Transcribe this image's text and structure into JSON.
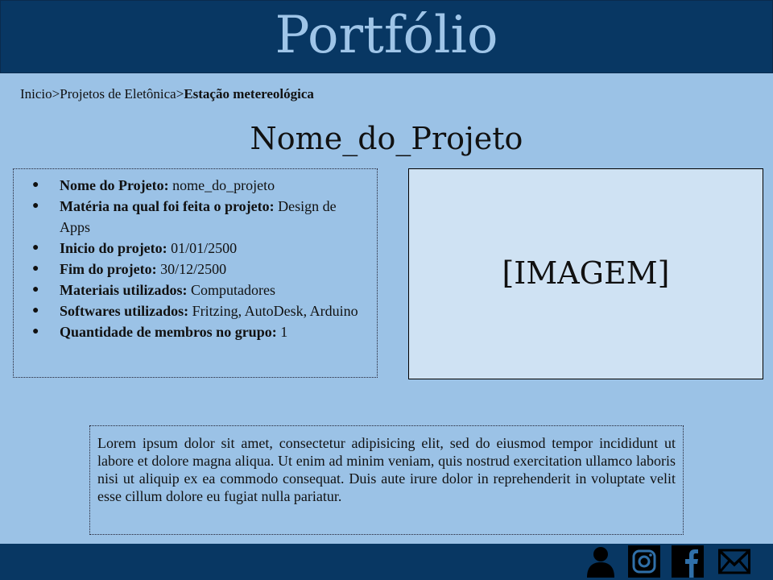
{
  "header": {
    "title": "Portfólio"
  },
  "breadcrumb": {
    "items": [
      "Inicio",
      "Projetos de Eletônica",
      "Estação metereológica"
    ],
    "separator": ">"
  },
  "page": {
    "title": "Nome_do_Projeto"
  },
  "info": {
    "items": [
      {
        "label": "Nome do Projeto:",
        "value": "nome_do_projeto"
      },
      {
        "label": "Matéria na qual foi feita o projeto:",
        "value": "Design de Apps"
      },
      {
        "label": "Inicio do projeto:",
        "value": "01/01/2500"
      },
      {
        "label": "Fim do projeto:",
        "value": "30/12/2500"
      },
      {
        "label": "Materiais utilizados:",
        "value": "Computadores"
      },
      {
        "label": "Softwares utilizados:",
        "value": "Fritzing, AutoDesk, Arduino"
      },
      {
        "label": "Quantidade de membros no grupo:",
        "value": "1"
      }
    ],
    "bullet": "●"
  },
  "image": {
    "placeholder": "[IMAGEM]"
  },
  "description": {
    "text": "Lorem ipsum dolor sit amet, consectetur adipisicing elit, sed do eiusmod tempor incididunt ut labore et dolore magna aliqua. Ut enim ad minim veniam, quis nostrud exercitation ullamco laboris nisi ut aliquip ex ea commodo consequat. Duis aute irure dolor in reprehenderit in voluptate velit esse cillum dolore eu fugiat nulla pariatur."
  },
  "footer": {
    "icons": [
      "person-icon",
      "instagram-icon",
      "facebook-icon",
      "mail-icon"
    ]
  },
  "colors": {
    "header_bg": "#083763",
    "header_text": "#9fc5e8",
    "page_bg": "#9bc2e6",
    "image_bg": "#cfe2f3"
  }
}
